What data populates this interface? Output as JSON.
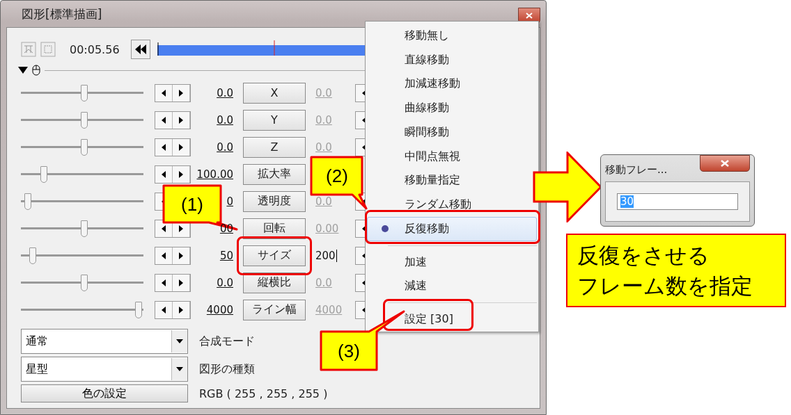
{
  "window": {
    "title": "図形[標準描画]"
  },
  "timeline": {
    "time": "00:05.56"
  },
  "rows": [
    {
      "level": 0.52,
      "value": "0.0",
      "label": "X",
      "end_value": "0.0",
      "editing": false
    },
    {
      "level": 0.52,
      "value": "0.0",
      "label": "Y",
      "end_value": "0.0",
      "editing": false
    },
    {
      "level": 0.52,
      "value": "0.0",
      "label": "Z",
      "end_value": "0.0",
      "editing": false
    },
    {
      "level": 0.17,
      "value": "100.00",
      "label": "拡大率"
    },
    {
      "level": 0.03,
      "value": "0",
      "label": "透明度",
      "end_value": "0.0",
      "editing": false
    },
    {
      "level": 0.52,
      "value": "00",
      "label": "回転",
      "end_value": "0.00",
      "editing": false
    },
    {
      "level": 0.07,
      "value": "50",
      "label": "サイズ",
      "end_value": "200",
      "editing": true
    },
    {
      "level": 0.52,
      "value": "0.0",
      "label": "縦横比",
      "end_value": "0.0",
      "editing": false
    },
    {
      "level": 0.99,
      "value": "4000",
      "label": "ライン幅",
      "end_value": "4000",
      "editing": false
    }
  ],
  "selects": [
    {
      "value": "通常",
      "label": "合成モード"
    },
    {
      "value": "星型",
      "label": "図形の種類"
    }
  ],
  "color": {
    "button": "色の設定",
    "value": "RGB ( 255 , 255 , 255 )"
  },
  "context_menu": {
    "sections": [
      [
        {
          "label": "移動無し",
          "selected": false
        },
        {
          "label": "直線移動",
          "selected": false
        },
        {
          "label": "加減速移動",
          "selected": false
        },
        {
          "label": "曲線移動",
          "selected": false
        },
        {
          "label": "瞬間移動",
          "selected": false
        },
        {
          "label": "中間点無視",
          "selected": false
        },
        {
          "label": "移動量指定",
          "selected": false
        },
        {
          "label": "ランダム移動",
          "selected": false
        },
        {
          "label": "反復移動",
          "selected": true
        }
      ],
      [
        {
          "label": "加速",
          "selected": false
        },
        {
          "label": "減速",
          "selected": false
        }
      ],
      [
        {
          "label": "設定 [30]",
          "selected": false
        }
      ]
    ]
  },
  "callouts": [
    "(1)",
    "(2)",
    "(3)"
  ],
  "dialog": {
    "title": "移動フレー...",
    "value": "30",
    "value_selected": true
  },
  "note": {
    "lines": [
      "反復をさせる",
      "フレーム数を指定"
    ]
  }
}
